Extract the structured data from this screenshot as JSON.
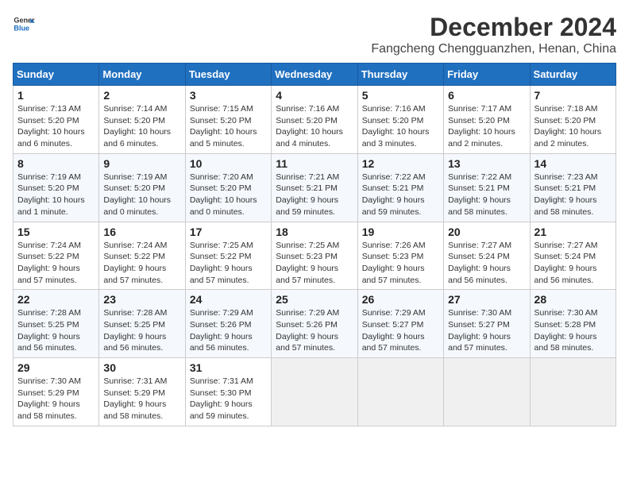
{
  "logo": {
    "line1": "General",
    "line2": "Blue"
  },
  "title": "December 2024",
  "location": "Fangcheng Chengguanzhen, Henan, China",
  "days_of_week": [
    "Sunday",
    "Monday",
    "Tuesday",
    "Wednesday",
    "Thursday",
    "Friday",
    "Saturday"
  ],
  "weeks": [
    [
      {
        "day": "1",
        "info": "Sunrise: 7:13 AM\nSunset: 5:20 PM\nDaylight: 10 hours\nand 6 minutes."
      },
      {
        "day": "2",
        "info": "Sunrise: 7:14 AM\nSunset: 5:20 PM\nDaylight: 10 hours\nand 6 minutes."
      },
      {
        "day": "3",
        "info": "Sunrise: 7:15 AM\nSunset: 5:20 PM\nDaylight: 10 hours\nand 5 minutes."
      },
      {
        "day": "4",
        "info": "Sunrise: 7:16 AM\nSunset: 5:20 PM\nDaylight: 10 hours\nand 4 minutes."
      },
      {
        "day": "5",
        "info": "Sunrise: 7:16 AM\nSunset: 5:20 PM\nDaylight: 10 hours\nand 3 minutes."
      },
      {
        "day": "6",
        "info": "Sunrise: 7:17 AM\nSunset: 5:20 PM\nDaylight: 10 hours\nand 2 minutes."
      },
      {
        "day": "7",
        "info": "Sunrise: 7:18 AM\nSunset: 5:20 PM\nDaylight: 10 hours\nand 2 minutes."
      }
    ],
    [
      {
        "day": "8",
        "info": "Sunrise: 7:19 AM\nSunset: 5:20 PM\nDaylight: 10 hours\nand 1 minute."
      },
      {
        "day": "9",
        "info": "Sunrise: 7:19 AM\nSunset: 5:20 PM\nDaylight: 10 hours\nand 0 minutes."
      },
      {
        "day": "10",
        "info": "Sunrise: 7:20 AM\nSunset: 5:20 PM\nDaylight: 10 hours\nand 0 minutes."
      },
      {
        "day": "11",
        "info": "Sunrise: 7:21 AM\nSunset: 5:21 PM\nDaylight: 9 hours\nand 59 minutes."
      },
      {
        "day": "12",
        "info": "Sunrise: 7:22 AM\nSunset: 5:21 PM\nDaylight: 9 hours\nand 59 minutes."
      },
      {
        "day": "13",
        "info": "Sunrise: 7:22 AM\nSunset: 5:21 PM\nDaylight: 9 hours\nand 58 minutes."
      },
      {
        "day": "14",
        "info": "Sunrise: 7:23 AM\nSunset: 5:21 PM\nDaylight: 9 hours\nand 58 minutes."
      }
    ],
    [
      {
        "day": "15",
        "info": "Sunrise: 7:24 AM\nSunset: 5:22 PM\nDaylight: 9 hours\nand 57 minutes."
      },
      {
        "day": "16",
        "info": "Sunrise: 7:24 AM\nSunset: 5:22 PM\nDaylight: 9 hours\nand 57 minutes."
      },
      {
        "day": "17",
        "info": "Sunrise: 7:25 AM\nSunset: 5:22 PM\nDaylight: 9 hours\nand 57 minutes."
      },
      {
        "day": "18",
        "info": "Sunrise: 7:25 AM\nSunset: 5:23 PM\nDaylight: 9 hours\nand 57 minutes."
      },
      {
        "day": "19",
        "info": "Sunrise: 7:26 AM\nSunset: 5:23 PM\nDaylight: 9 hours\nand 57 minutes."
      },
      {
        "day": "20",
        "info": "Sunrise: 7:27 AM\nSunset: 5:24 PM\nDaylight: 9 hours\nand 56 minutes."
      },
      {
        "day": "21",
        "info": "Sunrise: 7:27 AM\nSunset: 5:24 PM\nDaylight: 9 hours\nand 56 minutes."
      }
    ],
    [
      {
        "day": "22",
        "info": "Sunrise: 7:28 AM\nSunset: 5:25 PM\nDaylight: 9 hours\nand 56 minutes."
      },
      {
        "day": "23",
        "info": "Sunrise: 7:28 AM\nSunset: 5:25 PM\nDaylight: 9 hours\nand 56 minutes."
      },
      {
        "day": "24",
        "info": "Sunrise: 7:29 AM\nSunset: 5:26 PM\nDaylight: 9 hours\nand 56 minutes."
      },
      {
        "day": "25",
        "info": "Sunrise: 7:29 AM\nSunset: 5:26 PM\nDaylight: 9 hours\nand 57 minutes."
      },
      {
        "day": "26",
        "info": "Sunrise: 7:29 AM\nSunset: 5:27 PM\nDaylight: 9 hours\nand 57 minutes."
      },
      {
        "day": "27",
        "info": "Sunrise: 7:30 AM\nSunset: 5:27 PM\nDaylight: 9 hours\nand 57 minutes."
      },
      {
        "day": "28",
        "info": "Sunrise: 7:30 AM\nSunset: 5:28 PM\nDaylight: 9 hours\nand 58 minutes."
      }
    ],
    [
      {
        "day": "29",
        "info": "Sunrise: 7:30 AM\nSunset: 5:29 PM\nDaylight: 9 hours\nand 58 minutes."
      },
      {
        "day": "30",
        "info": "Sunrise: 7:31 AM\nSunset: 5:29 PM\nDaylight: 9 hours\nand 58 minutes."
      },
      {
        "day": "31",
        "info": "Sunrise: 7:31 AM\nSunset: 5:30 PM\nDaylight: 9 hours\nand 59 minutes."
      },
      {
        "day": "",
        "info": ""
      },
      {
        "day": "",
        "info": ""
      },
      {
        "day": "",
        "info": ""
      },
      {
        "day": "",
        "info": ""
      }
    ]
  ]
}
